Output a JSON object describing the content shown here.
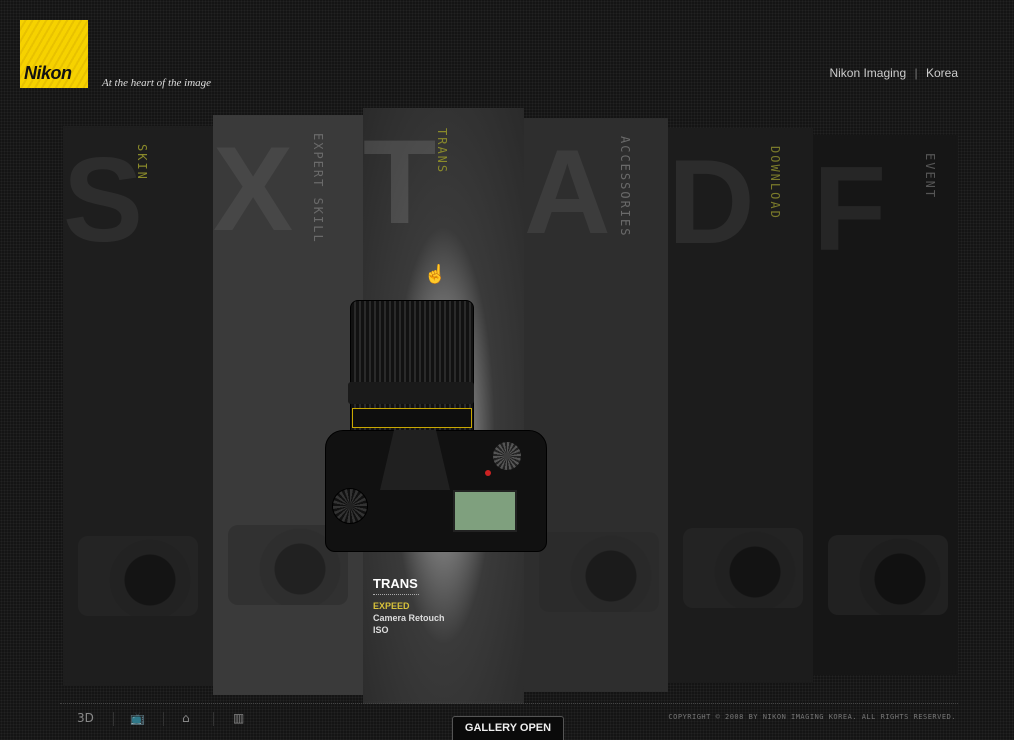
{
  "brand": {
    "logo": "Nikon",
    "tagline": "At the heart of the image"
  },
  "topnav": {
    "imaging": "Nikon Imaging",
    "separator": "|",
    "region": "Korea"
  },
  "panels": [
    {
      "letter": "S",
      "label": "SKIN",
      "label_color": "#8a8a2a"
    },
    {
      "letter": "X",
      "label": "EXPERT SKILL",
      "label_color": "#6a6a6a"
    },
    {
      "letter": "T",
      "label": "TRANS",
      "label_color": "#8a8a2a"
    },
    {
      "letter": "A",
      "label": "ACCESSORIES",
      "label_color": "#6a6a6a"
    },
    {
      "letter": "D",
      "label": "DOWNLOAD",
      "label_color": "#7a7a2a"
    },
    {
      "letter": "F",
      "label": "EVENT",
      "label_color": "#555555"
    }
  ],
  "feature": {
    "title": "TRANS",
    "items": [
      "EXPEED",
      "Camera Retouch",
      "ISO"
    ]
  },
  "footer": {
    "icons": [
      "3D",
      "tv-icon",
      "home-icon",
      "chart-icon"
    ],
    "icon_3d_label": "3D",
    "gallery_button": "GALLERY OPEN",
    "copyright": "COPYRIGHT © 2008 BY NIKON IMAGING KOREA. ALL RIGHTS RESERVED."
  },
  "colors": {
    "brand_yellow": "#f6d200",
    "highlight": "#d8c23a"
  }
}
